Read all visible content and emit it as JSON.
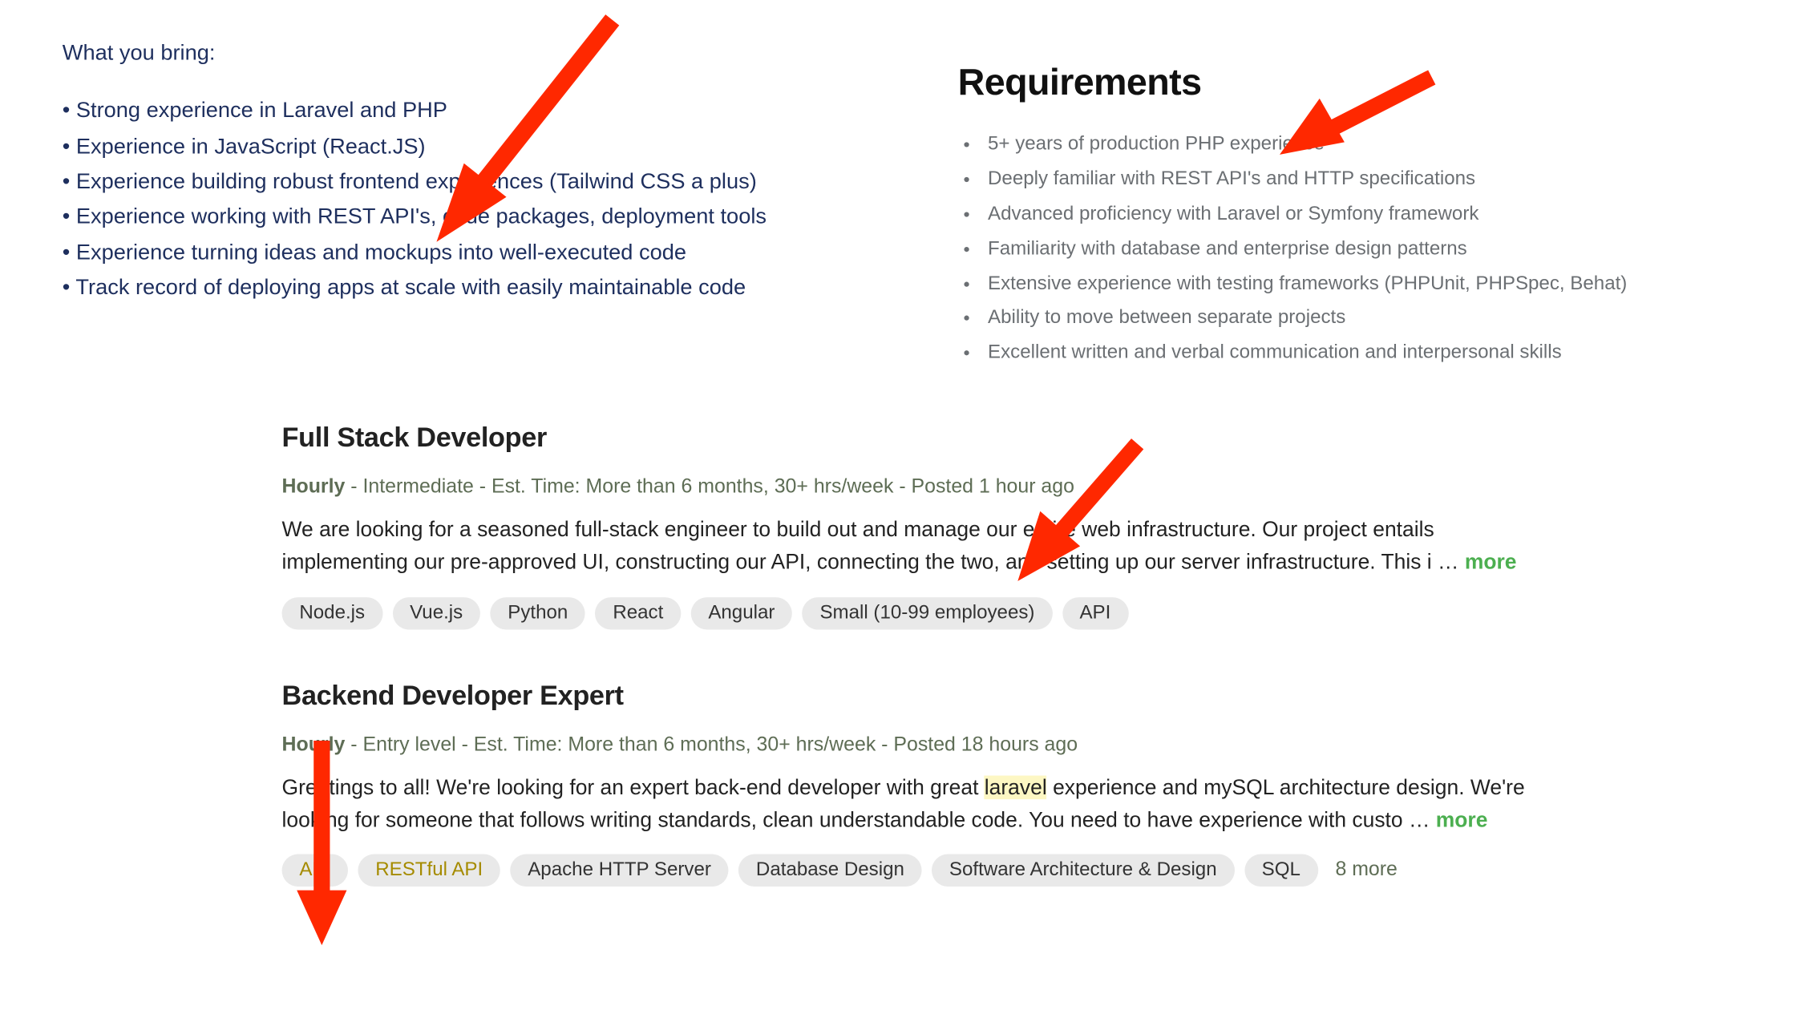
{
  "left": {
    "heading": "What you bring:",
    "items": [
      "Strong experience in Laravel and PHP",
      "Experience in JavaScript (React.JS)",
      "Experience building robust frontend experiences (Tailwind CSS a plus)",
      "Experience working with REST API's, code packages, deployment tools",
      "Experience turning ideas and mockups into well-executed code",
      "Track record of deploying apps at scale with easily maintainable code"
    ]
  },
  "right": {
    "heading": "Requirements",
    "items": [
      "5+ years of production PHP experience",
      "Deeply familiar with REST API's and HTTP specifications",
      "Advanced proficiency with Laravel or Symfony framework",
      "Familiarity with database and enterprise design patterns",
      "Extensive experience with testing frameworks (PHPUnit, PHPSpec, Behat)",
      "Ability to move between separate projects",
      "Excellent written and verbal communication and interpersonal skills"
    ]
  },
  "jobs": [
    {
      "title": "Full Stack Developer",
      "pay_type": "Hourly",
      "level": "Intermediate",
      "time": "Est. Time: More than 6 months, 30+ hrs/week",
      "posted": "Posted 1 hour ago",
      "description_pre": "We are looking for a seasoned full-stack engineer to build out and manage our entire web infrastructure. Our project entails implementing our pre-approved UI, constructing our API, connecting the two, and setting up our server infrastructure. This i … ",
      "more": "more",
      "tags": [
        "Node.js",
        "Vue.js",
        "Python",
        "React",
        "Angular",
        "Small (10-99 employees)",
        "API"
      ],
      "highlight_tags": []
    },
    {
      "title": "Backend Developer Expert",
      "pay_type": "Hourly",
      "level": "Entry level",
      "time": "Est. Time: More than 6 months, 30+ hrs/week",
      "posted": "Posted 18 hours ago",
      "description_pre": "Greetings to all! We're looking for an expert back-end developer with great ",
      "highlight_word": "laravel",
      "description_post": " experience and mySQL architecture design. We're looking for someone that follows writing standards, clean understandable code. You need to have experience with custo … ",
      "more": "more",
      "tags": [
        "API",
        "RESTful API",
        "Apache HTTP Server",
        "Database Design",
        "Software Architecture & Design",
        "SQL"
      ],
      "highlight_tags": [
        "API",
        "RESTful API"
      ],
      "more_tags": "8 more"
    }
  ]
}
